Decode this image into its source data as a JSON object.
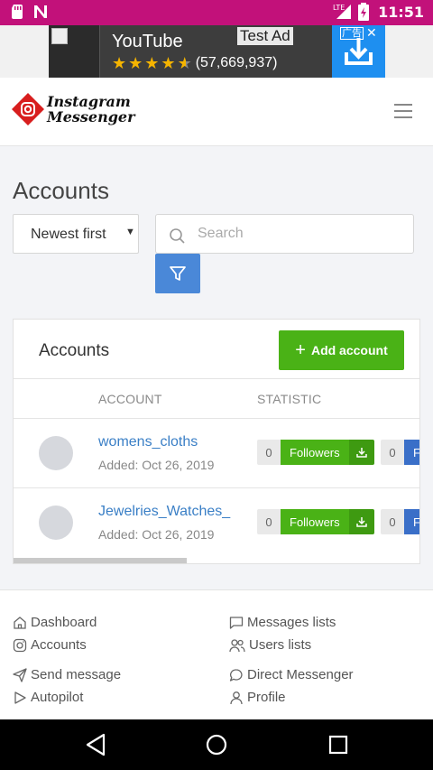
{
  "status_bar": {
    "time": "11:51",
    "network": "LTE",
    "left_icons": [
      "sd-card-icon",
      "n-notification-icon"
    ],
    "right_icons": [
      "signal-icon",
      "battery-icon"
    ],
    "color": "#c2117a"
  },
  "ad": {
    "title": "YouTube",
    "badge": "Test Ad",
    "rating_count": "(57,669,937)",
    "stars": 4.5,
    "adchoices_label": "广告",
    "close_label": "✕"
  },
  "header": {
    "logo_line1": "Instagram",
    "logo_line2": "Messenger",
    "menu_icon": "hamburger-icon"
  },
  "page": {
    "title": "Accounts",
    "sort_value": "Newest first",
    "search_placeholder": "Search",
    "filter_icon": "filter-icon"
  },
  "card": {
    "title": "Accounts",
    "add_button": "Add account",
    "columns": [
      "ACCOUNT",
      "STATISTIC"
    ],
    "rows": [
      {
        "name": "womens_cloths",
        "added": "Added: Oct 26, 2019",
        "stat1_count": "0",
        "stat1_label": "Followers",
        "stat2_count": "0",
        "stat2_label": "Fo"
      },
      {
        "name": "Jewelries_Watches_",
        "added": "Added: Oct 26, 2019",
        "stat1_count": "0",
        "stat1_label": "Followers",
        "stat2_count": "0",
        "stat2_label": "Fo"
      }
    ]
  },
  "footer": {
    "left": [
      {
        "label": "Dashboard",
        "icon": "home-icon"
      },
      {
        "label": "Accounts",
        "icon": "instagram-icon"
      },
      {
        "label": "Send message",
        "icon": "paper-plane-icon"
      },
      {
        "label": "Autopilot",
        "icon": "play-icon"
      }
    ],
    "right": [
      {
        "label": "Messages lists",
        "icon": "chat-square-icon"
      },
      {
        "label": "Users lists",
        "icon": "users-icon"
      },
      {
        "label": "Direct Messenger",
        "icon": "chat-bubble-icon"
      },
      {
        "label": "Profile",
        "icon": "user-icon"
      }
    ]
  },
  "colors": {
    "accent_green": "#4ab216",
    "accent_blue": "#4a88d8",
    "link": "#3a7fc6"
  }
}
